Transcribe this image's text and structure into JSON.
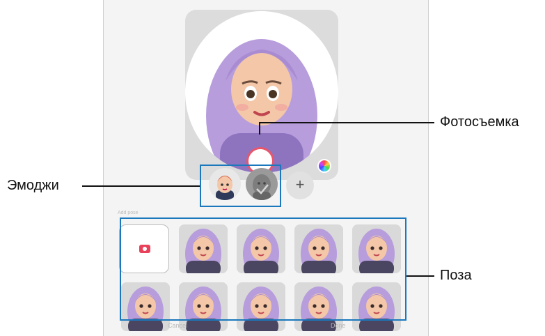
{
  "labels": {
    "photo": "Фотосъемка",
    "emoji": "Эмоджи",
    "pose": "Поза"
  },
  "screen": {
    "add_label": "+",
    "section_label": "Add pose",
    "cancel_label": "Cancel",
    "done_label": "Done"
  },
  "colors": {
    "callout_box": "#1b78bd",
    "shutter_ring": "#e8566b",
    "camera_icon": "#e9415a",
    "avatar_hair": "#b79ddc"
  },
  "icons": [
    "camera-icon",
    "plus-icon",
    "color-palette-icon"
  ]
}
